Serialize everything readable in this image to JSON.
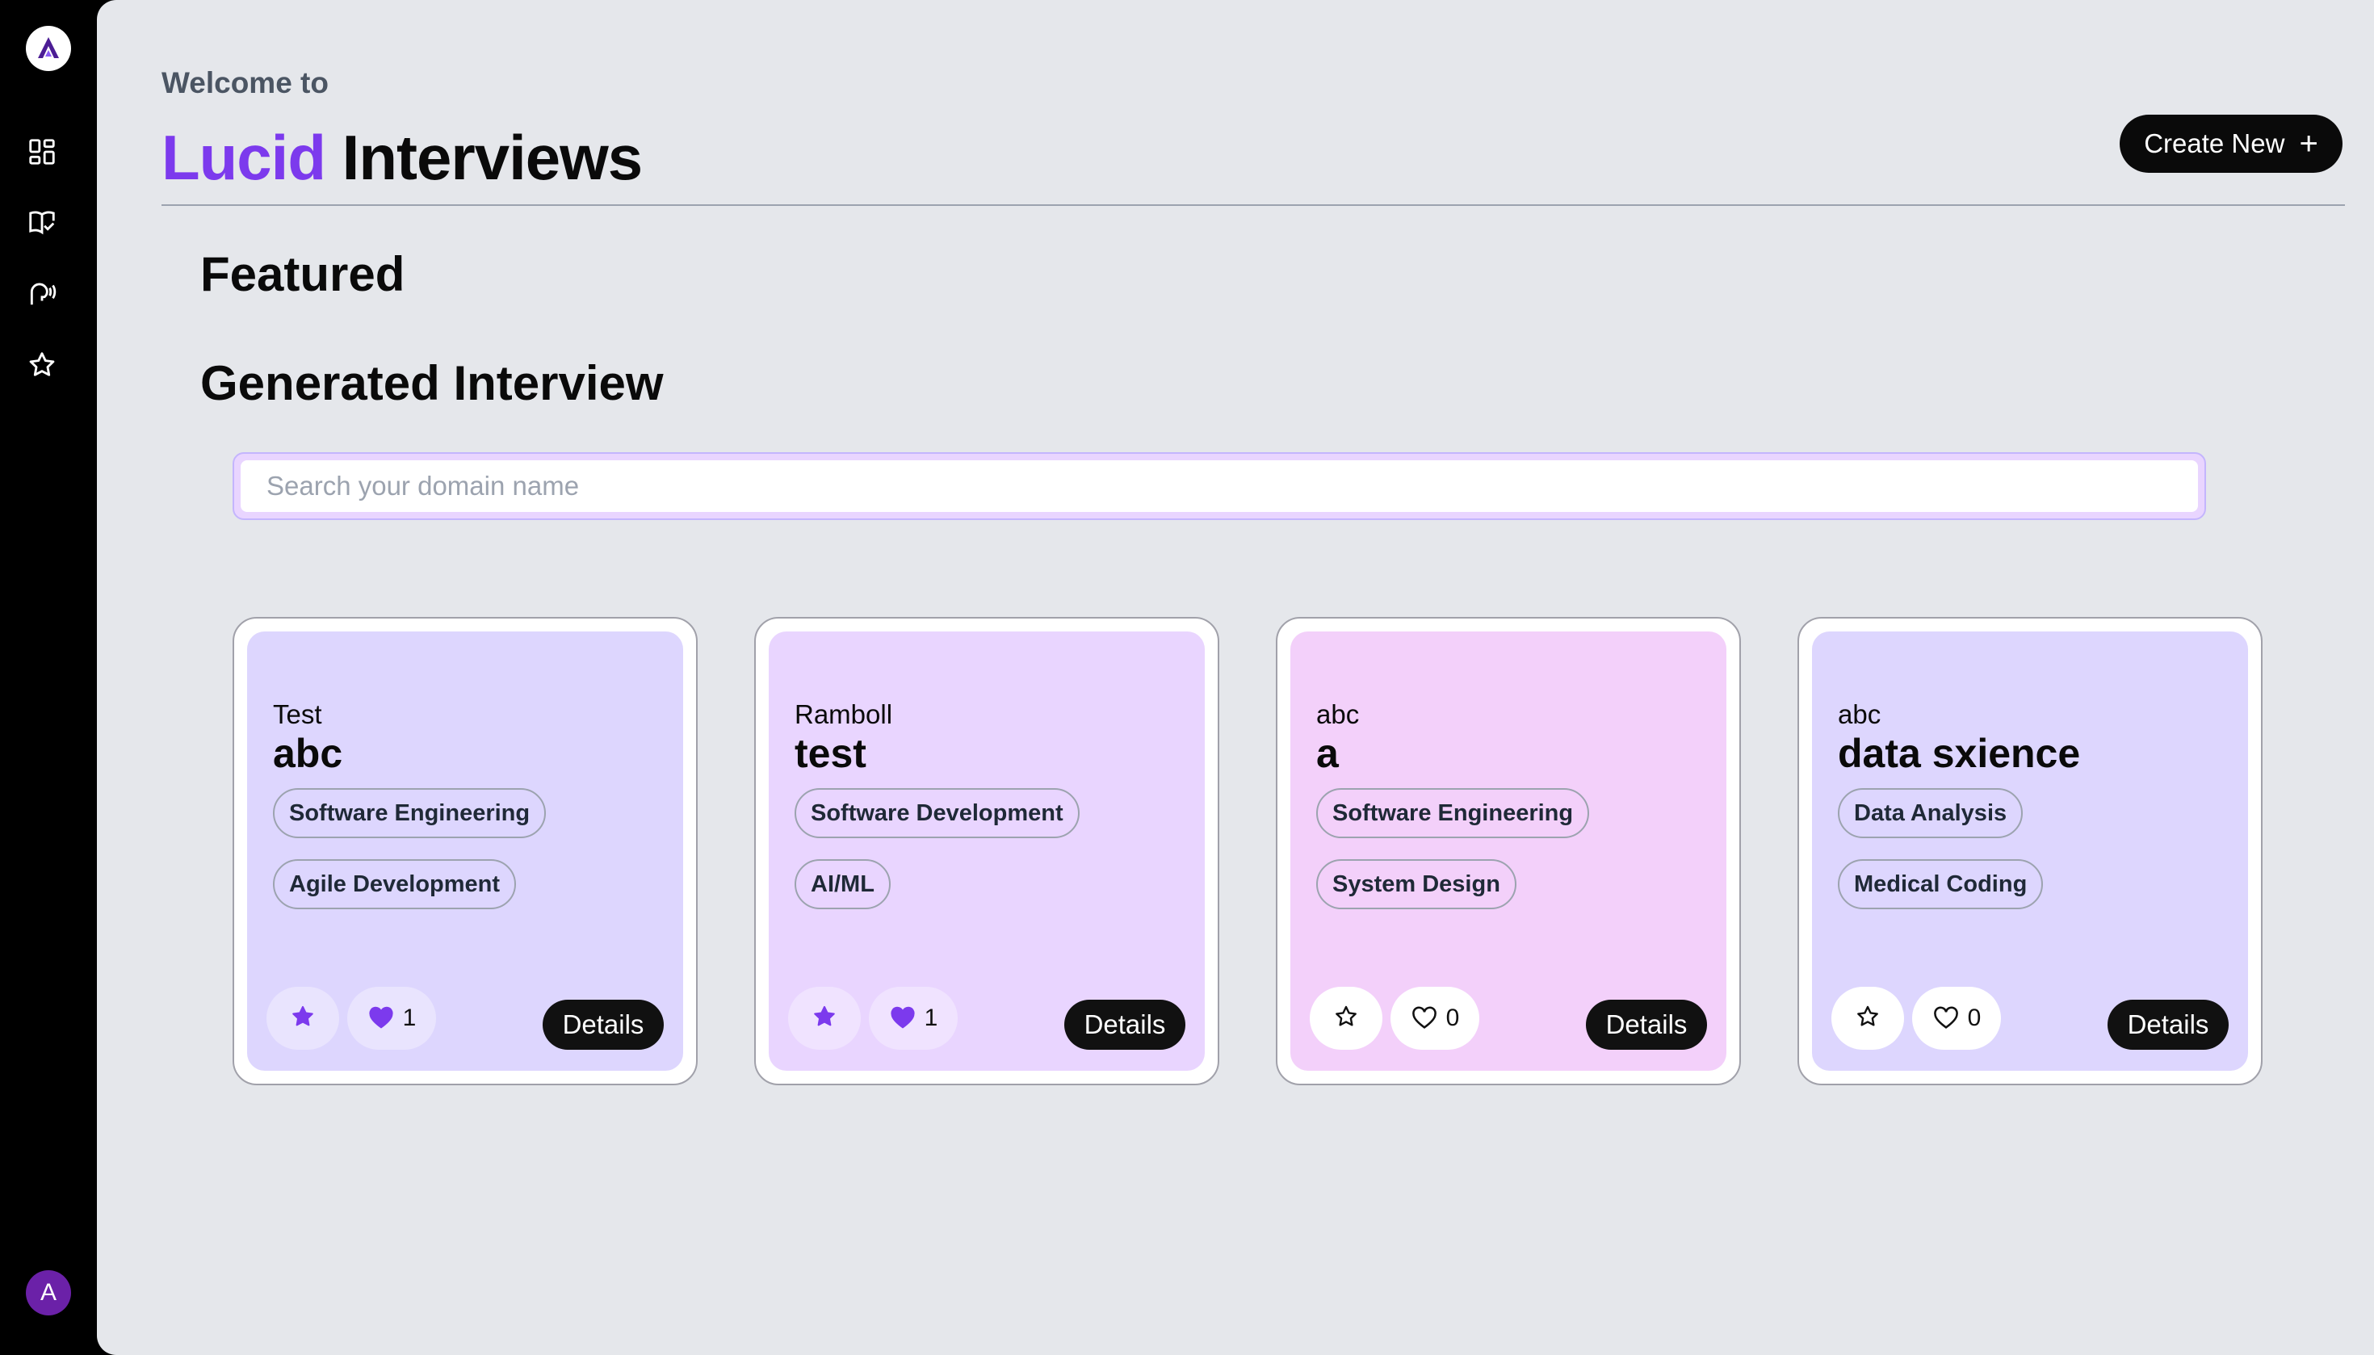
{
  "sidebar": {
    "logo": "lucid-logo",
    "items": [
      {
        "icon": "dashboard-icon"
      },
      {
        "icon": "book-check-icon"
      },
      {
        "icon": "speaking-head-icon"
      },
      {
        "icon": "star-icon"
      }
    ],
    "avatar_initial": "A"
  },
  "header": {
    "welcome": "Welcome to",
    "title_accent": "Lucid",
    "title_rest": "Interviews",
    "create_label": "Create New",
    "create_icon": "+"
  },
  "sections": {
    "featured": "Featured",
    "generated": "Generated Interview"
  },
  "search": {
    "placeholder": "Search your domain name",
    "value": ""
  },
  "cards": [
    {
      "company": "Test",
      "role": "abc",
      "tags": [
        "Software Engineering",
        "Agile Development"
      ],
      "starred": true,
      "liked": true,
      "likes": "1",
      "details_label": "Details",
      "bg": "#ddd6fe"
    },
    {
      "company": "Ramboll",
      "role": "test",
      "tags": [
        "Software Development",
        "AI/ML"
      ],
      "starred": true,
      "liked": true,
      "likes": "1",
      "details_label": "Details",
      "bg": "#e9d5ff"
    },
    {
      "company": "abc",
      "role": "a",
      "tags": [
        "Software Engineering",
        "System Design"
      ],
      "starred": false,
      "liked": false,
      "likes": "0",
      "details_label": "Details",
      "bg": "#f3d0fa"
    },
    {
      "company": "abc",
      "role": "data sxience",
      "tags": [
        "Data Analysis",
        "Medical Coding"
      ],
      "starred": false,
      "liked": false,
      "likes": "0",
      "details_label": "Details",
      "bg": "#ddd6fe"
    }
  ],
  "colors": {
    "accent": "#7c3aed",
    "dark": "#0a0a0a",
    "main_bg": "#e5e7eb"
  }
}
